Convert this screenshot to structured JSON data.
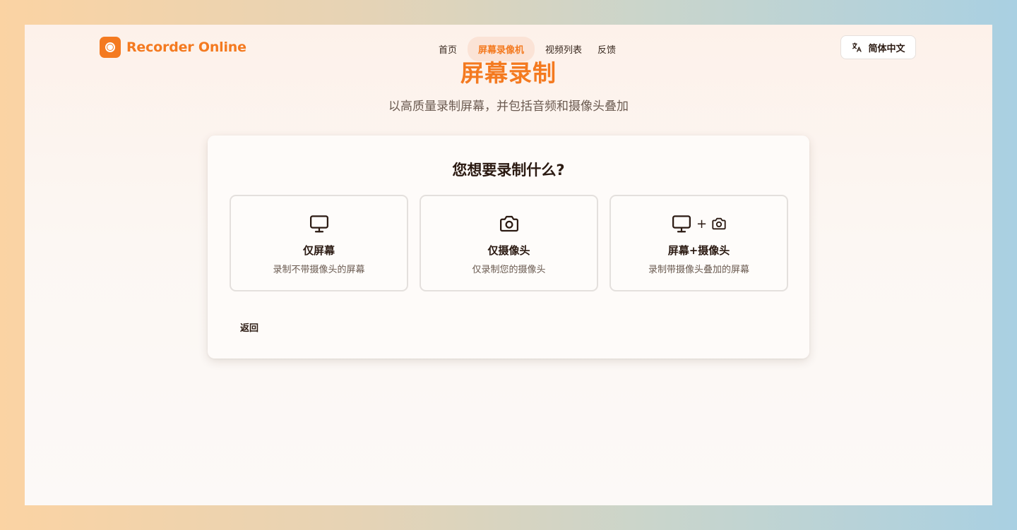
{
  "header": {
    "logo_text": "Recorder Online",
    "nav": [
      {
        "label": "首页",
        "active": false
      },
      {
        "label": "屏幕录像机",
        "active": true
      },
      {
        "label": "视频列表",
        "active": false
      },
      {
        "label": "反馈",
        "active": false
      }
    ],
    "language_label": "简体中文",
    "language_icon": "translate-icon"
  },
  "hero": {
    "title": "屏幕录制",
    "subtitle": "以高质量录制屏幕，并包括音频和摄像头叠加"
  },
  "card": {
    "question": "您想要录制什么?",
    "options": [
      {
        "icons": [
          "monitor-icon"
        ],
        "title": "仅屏幕",
        "desc": "录制不带摄像头的屏幕"
      },
      {
        "icons": [
          "camera-icon"
        ],
        "title": "仅摄像头",
        "desc": "仅录制您的摄像头"
      },
      {
        "icons": [
          "monitor-icon",
          "camera-icon"
        ],
        "plus": "+",
        "title": "屏幕+摄像头",
        "desc": "录制带摄像头叠加的屏幕"
      }
    ],
    "back_label": "返回"
  },
  "colors": {
    "accent": "#f47a20",
    "text": "#2b1a12",
    "muted": "#6a5a50"
  }
}
